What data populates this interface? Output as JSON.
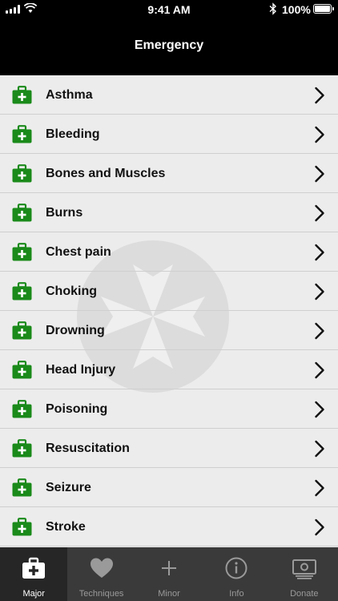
{
  "status_bar": {
    "time": "9:41 AM",
    "battery": "100%"
  },
  "nav": {
    "title": "Emergency"
  },
  "list": {
    "items": [
      {
        "label": "Asthma"
      },
      {
        "label": "Bleeding"
      },
      {
        "label": "Bones and Muscles"
      },
      {
        "label": "Burns"
      },
      {
        "label": "Chest pain"
      },
      {
        "label": "Choking"
      },
      {
        "label": "Drowning"
      },
      {
        "label": "Head Injury"
      },
      {
        "label": "Poisoning"
      },
      {
        "label": "Resuscitation"
      },
      {
        "label": "Seizure"
      },
      {
        "label": "Stroke"
      }
    ]
  },
  "tabs": [
    {
      "label": "Major",
      "icon": "first-aid-kit-icon",
      "active": true
    },
    {
      "label": "Techniques",
      "icon": "heart-icon",
      "active": false
    },
    {
      "label": "Minor",
      "icon": "plus-icon",
      "active": false
    },
    {
      "label": "Info",
      "icon": "info-icon",
      "active": false
    },
    {
      "label": "Donate",
      "icon": "banknote-icon",
      "active": false
    }
  ],
  "colors": {
    "kit_green": "#1a8a1a",
    "nav_bg": "#000000",
    "list_bg": "#ececec",
    "tab_bg": "#3a3a3a",
    "tab_active_bg": "#262626"
  }
}
